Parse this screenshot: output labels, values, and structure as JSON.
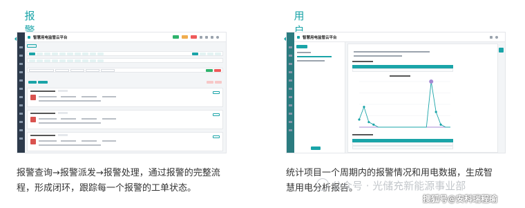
{
  "left_panel": {
    "heading": "报警管理",
    "description_line1": "报警查询→报警派发→报警处理，通过报警的完整流",
    "description_line2": "程，形成闭环，跟踪每一个报警的工单状态。",
    "screenshot": {
      "app_title": "智慧用电监管云平台"
    }
  },
  "right_panel": {
    "heading": "用户报告",
    "description_line1": "统计项目一个周期内的报警情况和用电数据，生成智",
    "description_line2": "慧用电分析报告。",
    "screenshot": {
      "app_title": "智慧用电监管云平台"
    }
  },
  "chart_data": {
    "type": "line",
    "x": [
      1,
      2,
      3,
      4,
      5,
      6,
      7,
      8,
      9,
      10,
      11,
      12,
      13,
      14,
      15,
      16,
      17,
      18,
      19,
      20
    ],
    "series": [
      {
        "values": [
          0,
          0,
          0,
          0,
          0,
          0,
          0,
          0,
          0,
          0,
          0,
          0,
          0,
          0,
          0,
          0,
          0,
          0,
          0,
          0
        ]
      },
      {
        "values": [
          3,
          8,
          2,
          1,
          0,
          0,
          0,
          0,
          0,
          0,
          0,
          0,
          0,
          0,
          0,
          18,
          6,
          1,
          0,
          0
        ]
      }
    ],
    "colors": [
      "#a48ad4",
      "#1aa4a8"
    ]
  },
  "watermark": {
    "line1": "公众号 · 光储充新能源事业部",
    "line2": "搜狐号@安科瑞程瑜"
  },
  "colors": {
    "accent": "#1aa4a8",
    "sidebar": "#2d3a4b",
    "alarm": "#d9534f"
  }
}
